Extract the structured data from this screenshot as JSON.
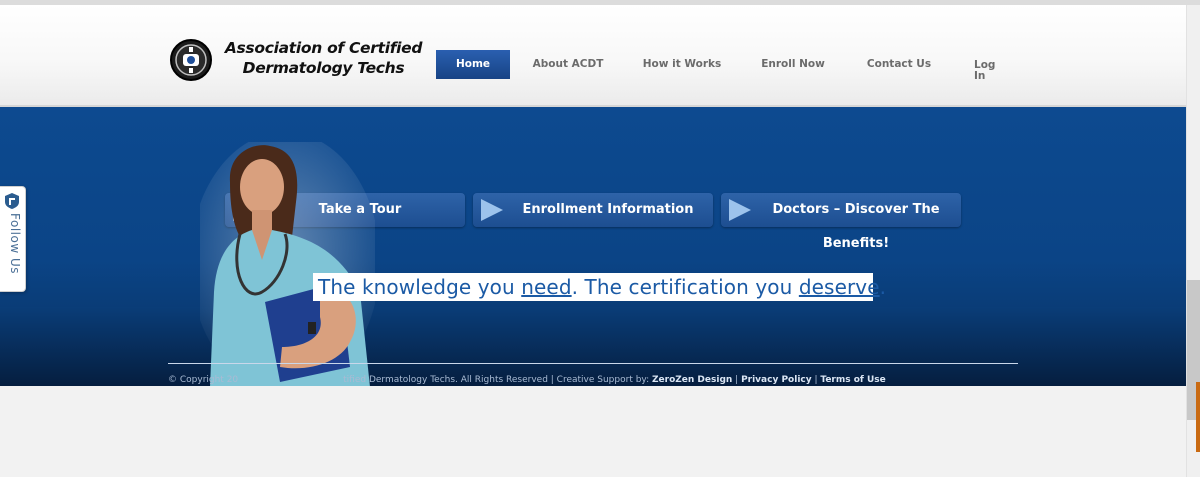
{
  "logo": {
    "line1": "Association of Certified",
    "line2": "Dermatology Techs"
  },
  "nav": {
    "home": "Home",
    "about": "About ACDT",
    "how": "How it Works",
    "enroll": "Enroll Now",
    "contact": "Contact Us",
    "login": "Log In"
  },
  "banner": {
    "cta_tour": "Take a Tour",
    "cta_enroll": "Enrollment Information",
    "cta_doctors": "Doctors – Discover The Benefits!",
    "tagline_part1": "The knowledge you ",
    "tagline_need": "need",
    "tagline_part2": ". The certification you ",
    "tagline_deserve": "deserve",
    "tagline_end": "."
  },
  "footer": {
    "copyright_start": "© Copyright 20",
    "copyright_end": "tified Dermatology Techs. All Rights Reserved | Creative Support by: ",
    "designer": "ZeroZen Design",
    "privacy": "Privacy Policy",
    "terms": "Terms of Use",
    "separator": " | "
  },
  "follow": {
    "label": "Follow Us"
  },
  "colors": {
    "accent": "#1f4f9a",
    "banner": "#0b4486",
    "tagline_text": "#1b5aa5"
  }
}
